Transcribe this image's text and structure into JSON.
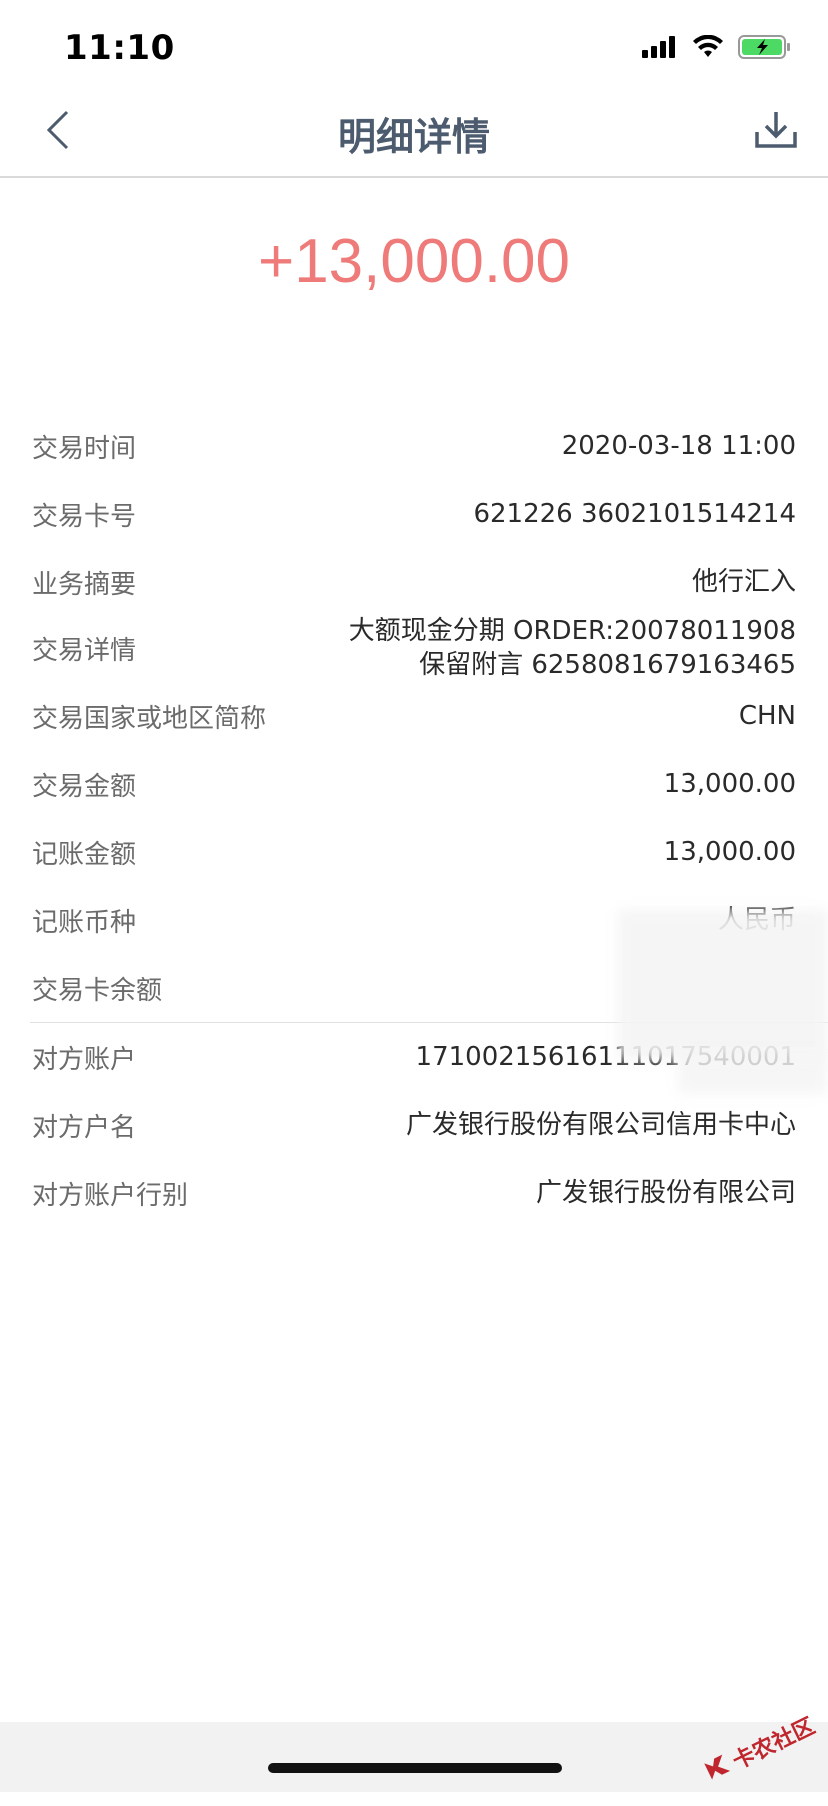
{
  "status_bar": {
    "time": "11:10",
    "icons": [
      "signal-icon",
      "wifi-icon",
      "battery-charging-icon"
    ]
  },
  "nav": {
    "title": "明细详情",
    "back_icon": "chevron-left-icon",
    "download_icon": "download-icon"
  },
  "amount": "+13,000.00",
  "colors": {
    "amount": "#ef7a7a",
    "nav_title": "#4c5b6e",
    "label": "#6b6b6b",
    "value": "#2a2a2a",
    "battery": "#4cd964"
  },
  "details": {
    "time": {
      "label": "交易时间",
      "value": "2020-03-18 11:00"
    },
    "card": {
      "label": "交易卡号",
      "value": "621226 3602101514214"
    },
    "summary": {
      "label": "业务摘要",
      "value": "他行汇入"
    },
    "detail": {
      "label": "交易详情",
      "value_line1": "大额现金分期 ORDER:20078011908",
      "value_line2": "保留附言 6258081679163465"
    },
    "country": {
      "label": "交易国家或地区简称",
      "value": "CHN"
    },
    "trade_amount": {
      "label": "交易金额",
      "value": "13,000.00"
    },
    "book_amount": {
      "label": "记账金额",
      "value": "13,000.00"
    },
    "currency": {
      "label": "记账币种",
      "value": "人民币"
    },
    "balance": {
      "label": "交易卡余额",
      "value": ""
    },
    "counter_account": {
      "label": "对方账户",
      "value": "17100215616111017540001"
    },
    "counter_name": {
      "label": "对方户名",
      "value": "广发银行股份有限公司信用卡中心"
    },
    "counter_bank": {
      "label": "对方账户行别",
      "value": "广发银行股份有限公司"
    }
  },
  "watermark": {
    "text": "卡农社区",
    "icon": "logo-icon"
  }
}
